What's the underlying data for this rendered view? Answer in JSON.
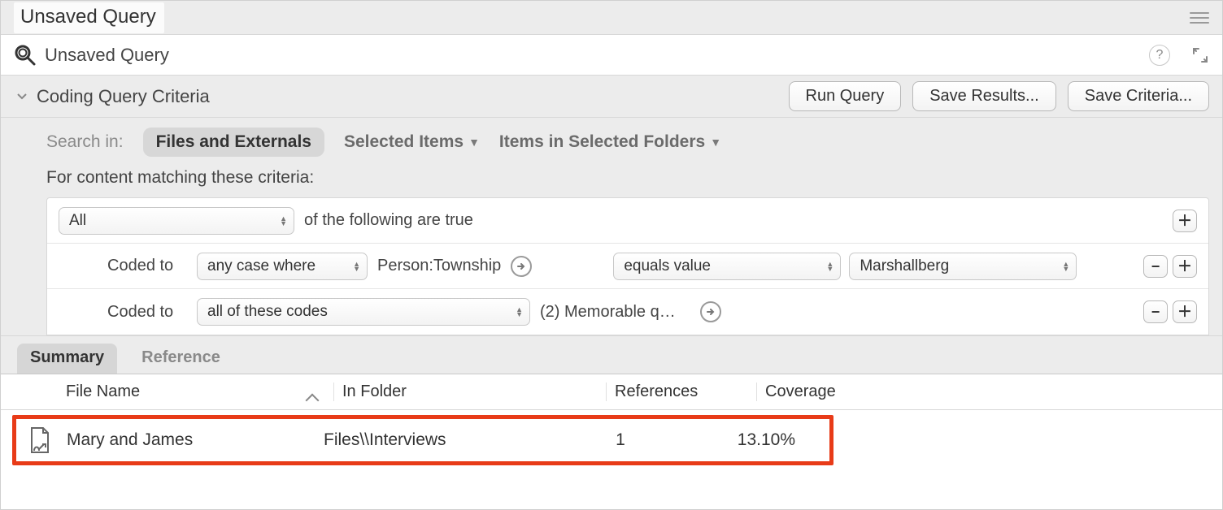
{
  "titlebar": {
    "title": "Unsaved Query"
  },
  "subheader": {
    "title": "Unsaved Query",
    "help": "?"
  },
  "criteria": {
    "heading": "Coding Query Criteria",
    "buttons": {
      "run": "Run Query",
      "save_results": "Save Results...",
      "save_criteria": "Save Criteria..."
    },
    "search_in_label": "Search in:",
    "scope_active": "Files and Externals",
    "scope_selected_items": "Selected Items",
    "scope_selected_folders": "Items in Selected Folders",
    "match_label": "For content matching these criteria:",
    "row_all": {
      "select": "All",
      "suffix": "of the following are true"
    },
    "row1": {
      "label": "Coded to",
      "case_select": "any case where",
      "attribute": "Person:Township",
      "op_select": "equals value",
      "value_select": "Marshallberg"
    },
    "row2": {
      "label": "Coded to",
      "codes_select": "all of these codes",
      "codes_value": "(2) Memorable q…"
    }
  },
  "tabs": {
    "summary": "Summary",
    "reference": "Reference"
  },
  "table": {
    "headers": {
      "file_name": "File Name",
      "in_folder": "In Folder",
      "references": "References",
      "coverage": "Coverage"
    },
    "rows": [
      {
        "file_name": "Mary and James",
        "in_folder": "Files\\\\Interviews",
        "references": "1",
        "coverage": "13.10%"
      }
    ]
  },
  "icons": {
    "plus": "＋",
    "minus": "−"
  }
}
